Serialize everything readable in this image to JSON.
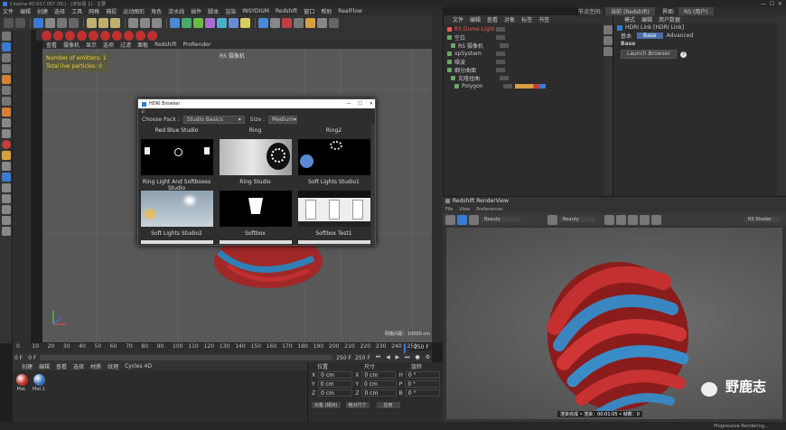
{
  "title_bar": {
    "app_title": "Cinema 4D R17.057 (RC) - [未标题 1] - 主要"
  },
  "menu": [
    "文件",
    "编辑",
    "创建",
    "选择",
    "工具",
    "网格",
    "捕捉",
    "运动图形",
    "角色",
    "流水线",
    "插件",
    "脚本",
    "渲染",
    "INSYDIUM",
    "Redshift",
    "窗口",
    "帮助",
    "RealFlow"
  ],
  "right_header": {
    "node_space_label": "节点空间:",
    "node_space_value": "当前 (Redshift)",
    "layout_label": "界面:",
    "layout_value": "RS (用户)"
  },
  "viewport_menu": [
    "查看",
    "摄像机",
    "显示",
    "选项",
    "过滤",
    "面板",
    "Redshift",
    "ProRender"
  ],
  "viewport": {
    "camera_label": "RS 摄像机",
    "stats": [
      "Number of emitters: 1",
      "Total live particles: 0"
    ],
    "grid_distance": "网格间距：10000 cm"
  },
  "hdri_browser": {
    "title": "HDRI Browser",
    "choose_pack_label": "Choose Pack :",
    "pack_value": "Studio Basics",
    "size_label": "Size :",
    "size_value": "Medium",
    "items": [
      {
        "label": "Red Blue Studio"
      },
      {
        "label": "Ring"
      },
      {
        "label": "Ring2"
      },
      {
        "label": "Ring Light And Softboxes Studio"
      },
      {
        "label": "Ring Studio"
      },
      {
        "label": "Soft Lights Studio1"
      },
      {
        "label": "Soft Lights Studio2"
      },
      {
        "label": "Softbox"
      },
      {
        "label": "Softbox Test1"
      }
    ],
    "window_controls": {
      "minimize": "—",
      "maximize": "☐",
      "close": "✕"
    }
  },
  "object_manager": {
    "menu": [
      "文件",
      "编辑",
      "查看",
      "对象",
      "标签",
      "书签"
    ],
    "objects": [
      {
        "name": "RS Dome Light",
        "color": "#e85a4f"
      },
      {
        "name": "空白",
        "color": "#c8c8c8"
      },
      {
        "name": "RS 摄像机",
        "color": "#c8c8c8"
      },
      {
        "name": "xpSystem",
        "color": "#c8c8c8"
      },
      {
        "name": "噪波",
        "color": "#c8c8c8"
      },
      {
        "name": "细分曲面",
        "color": "#c8c8c8"
      },
      {
        "name": "克隆扭曲",
        "color": "#c8c8c8"
      },
      {
        "name": "Polygon",
        "color": "#c8c8c8"
      }
    ]
  },
  "attributes": {
    "menu": [
      "模式",
      "编辑",
      "用户数据"
    ],
    "object_name": "HDRI Link [HDRI Link]",
    "tabs": [
      "基本",
      "Base",
      "Advanced"
    ],
    "section": "Base",
    "launch_button": "Launch Browser"
  },
  "render_view": {
    "title": "Redshift RenderView",
    "menu": [
      "File",
      "View",
      "Preferences"
    ],
    "dropdown_left": "Beauty",
    "dropdown_mid": "Beauty",
    "dropdown_right": "RS Shader",
    "status": "渲染完成 • 渲染：00:01:05 • 帧数：0",
    "watermark": "野鹿志"
  },
  "timeline": {
    "ticks": [
      "0",
      "10",
      "20",
      "30",
      "40",
      "50",
      "60",
      "70",
      "80",
      "90",
      "100",
      "110",
      "120",
      "130",
      "140",
      "150",
      "160",
      "170",
      "180",
      "190",
      "200",
      "210",
      "220",
      "230",
      "240",
      "250"
    ],
    "current_frame": "0 F",
    "start_field": "0 F",
    "end_field": "250 F",
    "end_field2": "250 F",
    "frame_counter": "250 F"
  },
  "material_manager": {
    "menu": [
      "创建",
      "编辑",
      "查看",
      "选择",
      "材质",
      "纹理",
      "Cycles 4D"
    ],
    "materials": [
      {
        "name": "Mat.",
        "color": "#c0302a"
      },
      {
        "name": "Mat.1",
        "color": "#3a6fb8"
      }
    ]
  },
  "coordinates": {
    "headers": [
      "位置",
      "尺寸",
      "旋转"
    ],
    "rows": [
      {
        "axis": "X",
        "pos": "0 cm",
        "size_axis": "X",
        "size": "0 cm",
        "rot_axis": "H",
        "rot": "0 °"
      },
      {
        "axis": "Y",
        "pos": "0 cm",
        "size_axis": "Y",
        "size": "0 cm",
        "rot_axis": "P",
        "rot": "0 °"
      },
      {
        "axis": "Z",
        "pos": "0 cm",
        "size_axis": "Z",
        "size": "0 cm",
        "rot_axis": "B",
        "rot": "0 °"
      }
    ],
    "mode_dropdown": "对象 (相对)",
    "size_dropdown": "绝对尺寸",
    "apply_button": "应用"
  },
  "status_bar": {
    "text": "Progressive Rendering..."
  },
  "colors": {
    "accent": "#2d7bd6",
    "dome_red": "#e85a4f",
    "viewport_bg": "#585858",
    "panel_bg": "#2c2c2c"
  }
}
